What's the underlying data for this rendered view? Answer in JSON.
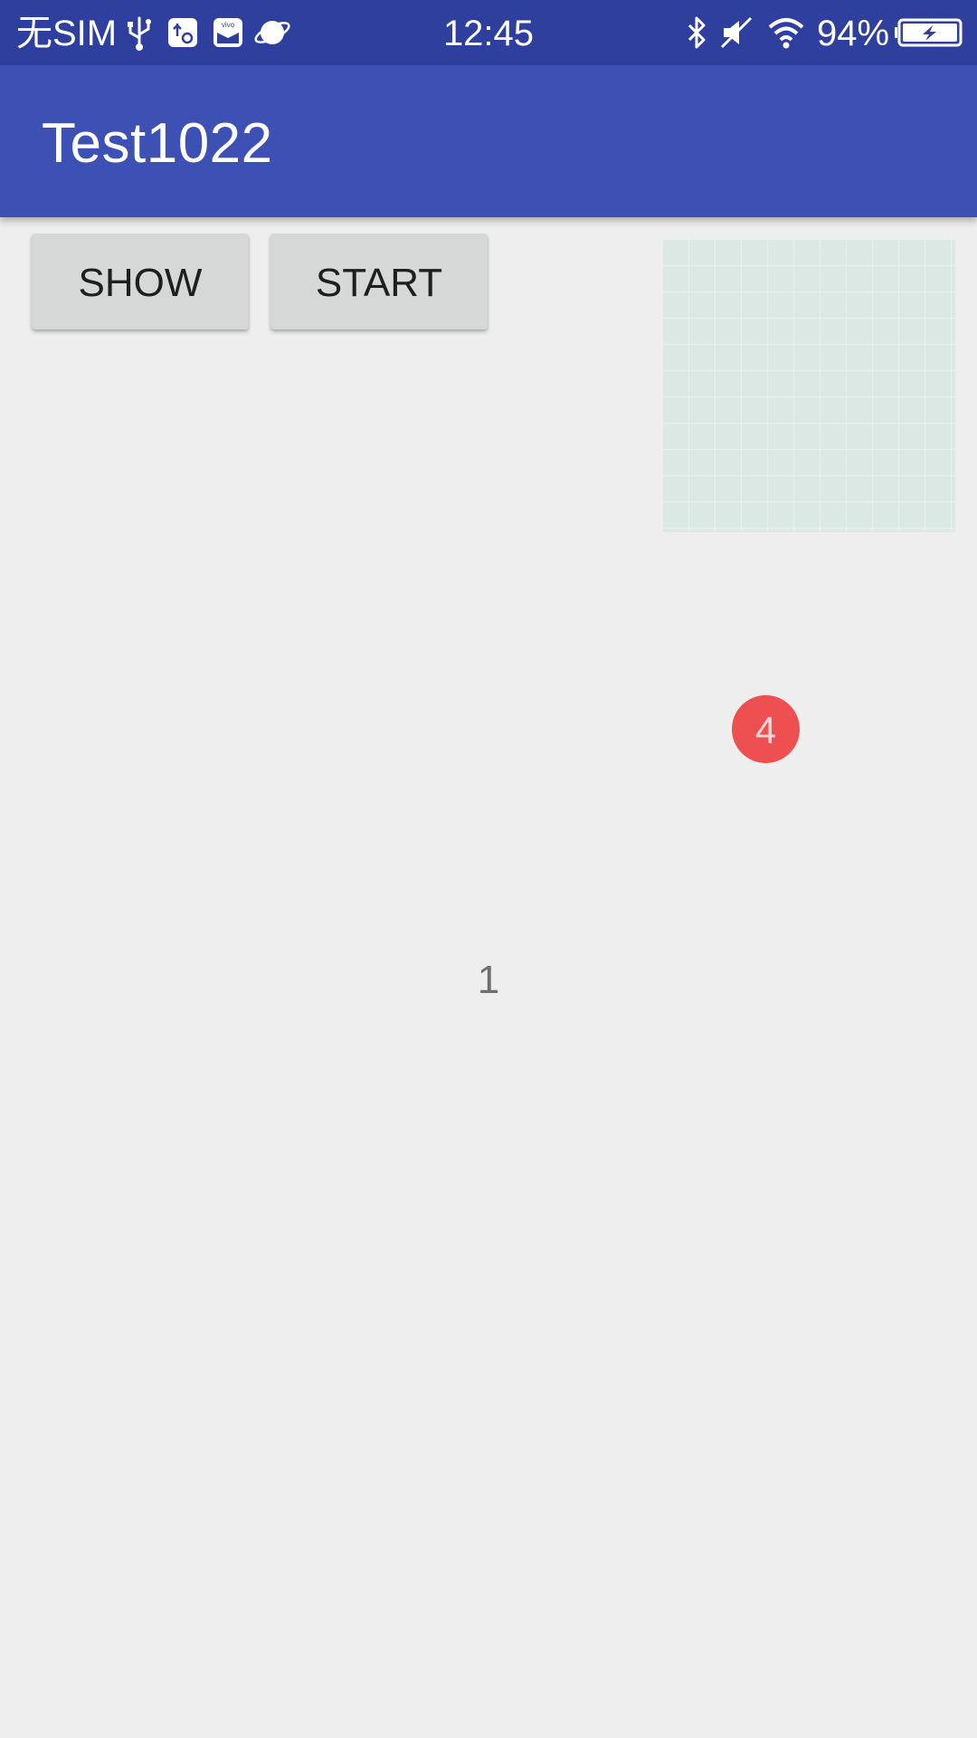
{
  "status_bar": {
    "carrier": "无SIM",
    "time": "12:45",
    "battery_percent": "94%",
    "left_icons": [
      "usb-icon",
      "usb-settings-icon",
      "vivo-app-icon",
      "browser-planet-icon"
    ],
    "right_icons": [
      "bluetooth-icon",
      "mute-icon",
      "wifi-icon",
      "battery-charging-icon"
    ]
  },
  "app_bar": {
    "title": "Test1022",
    "color": "#3d51b5"
  },
  "buttons": {
    "show_label": "SHOW",
    "start_label": "START"
  },
  "badge": {
    "count": "4",
    "color": "#ee4f50"
  },
  "counter": {
    "value": "1"
  }
}
